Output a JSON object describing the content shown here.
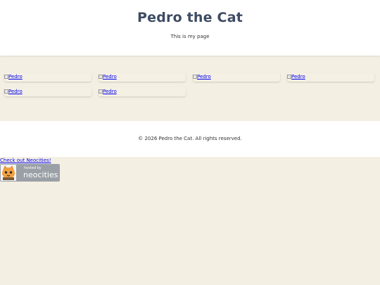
{
  "header": {
    "title": "Pedro the Cat",
    "subtitle": "This is my page"
  },
  "gallery": {
    "items": [
      {
        "alt": "Pedro"
      },
      {
        "alt": "Pedro"
      },
      {
        "alt": "Pedro"
      },
      {
        "alt": "Pedro"
      },
      {
        "alt": "Pedro"
      },
      {
        "alt": "Pedro"
      }
    ]
  },
  "footer": {
    "copyright": "© 2026 Pedro the Cat. All rights reserved."
  },
  "neocities": {
    "link_text": "Check out Neocities!",
    "badge_small": "hosted by",
    "badge_brand": "neocities"
  },
  "colors": {
    "page_bg": "#f4efe3",
    "title": "#3d4b63",
    "link": "#0000ee"
  }
}
